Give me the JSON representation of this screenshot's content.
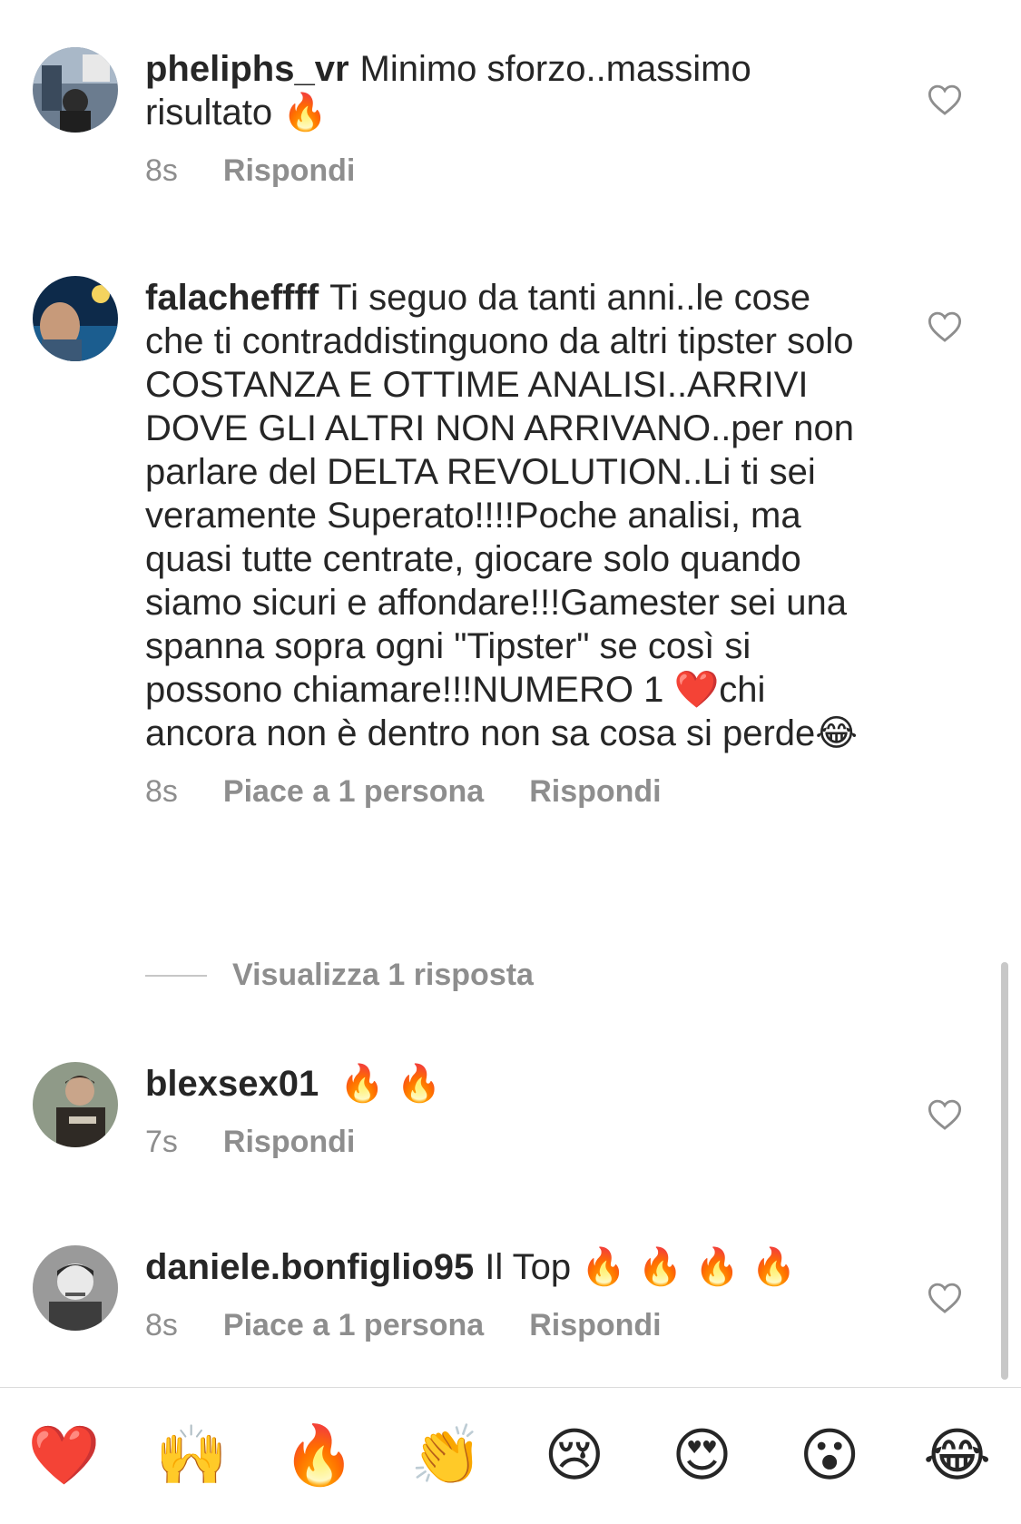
{
  "comments": [
    {
      "username": "pheliphs_vr",
      "text": "Minimo sforzo..massimo risultato",
      "emoji": "🔥",
      "time": "8s",
      "likes_label": "",
      "reply_label": "Rispondi"
    },
    {
      "username": "falacheffff",
      "text": "Ti seguo da tanti anni..le cose che ti contraddistinguono da altri tipster solo COSTANZA E OTTIME ANALISI..ARRIVI DOVE GLI ALTRI NON ARRIVANO..per non parlare del DELTA REVOLUTION..Li ti sei veramente Superato!!!!Poche analisi, ma quasi tutte centrate, giocare solo quando siamo sicuri e affondare!!!Gamester sei una spanna sopra ogni \"Tipster\" se così si possono chiamare!!!NUMERO 1 ",
      "emoji_mid": "❤️",
      "text_after": "chi ancora non è dentro non sa cosa si perde",
      "emoji": "😂",
      "time": "8s",
      "likes_label": "Piace a 1 persona",
      "reply_label": "Rispondi",
      "view_replies": "Visualizza 1 risposta"
    },
    {
      "username": "blexsex01",
      "text": "",
      "emoji": "🔥 🔥",
      "time": "7s",
      "likes_label": "",
      "reply_label": "Rispondi"
    },
    {
      "username": "daniele.bonfiglio95",
      "text": "Il Top",
      "emoji": "🔥 🔥 🔥 🔥",
      "time": "8s",
      "likes_label": "Piace a 1 persona",
      "reply_label": "Rispondi"
    }
  ],
  "quick_reactions": [
    "❤️",
    "🙌",
    "🔥",
    "👏",
    "😢",
    "😍",
    "😮",
    "😂"
  ],
  "colors": {
    "text": "#262626",
    "secondary": "#8e8e8e",
    "divider": "#dbdbdb",
    "fire": "#ff6a00",
    "heart": "#e0202a"
  },
  "icons": {
    "like": "heart-outline-icon"
  }
}
